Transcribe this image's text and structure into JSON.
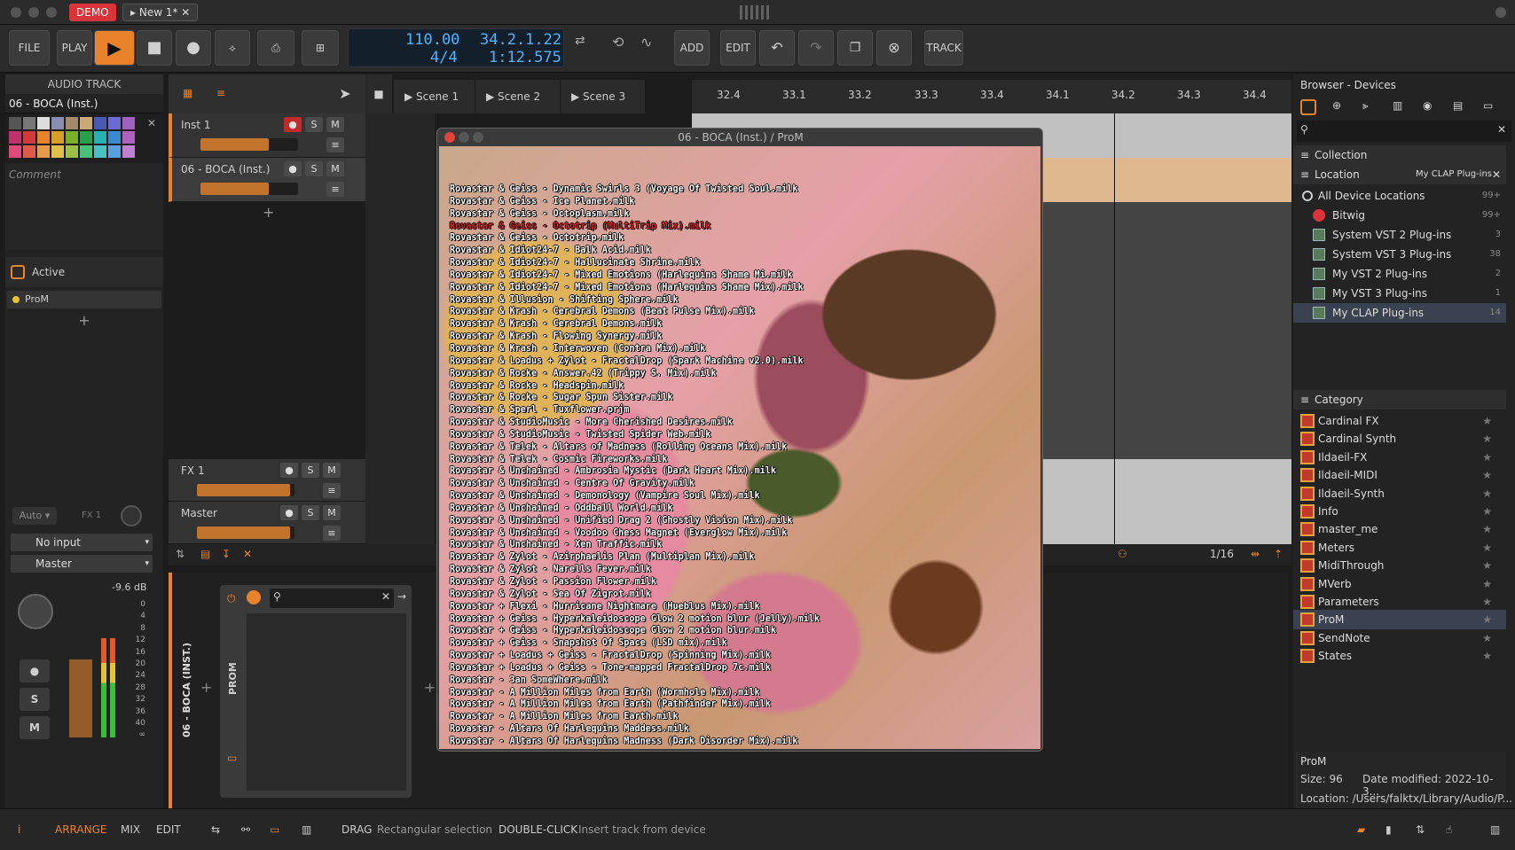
{
  "window": {
    "demo": "DEMO",
    "doc_tab": "New 1*",
    "tab_close": "✕"
  },
  "toolbar": {
    "file": "FILE",
    "play": "PLAY",
    "add": "ADD",
    "edit": "EDIT",
    "track": "TRACK",
    "tempo": "110.00",
    "signature": "4/4",
    "position": "34.2.1.22",
    "time": "1:12.575"
  },
  "inspector": {
    "title": "AUDIO TRACK",
    "track_name": "06 - BOCA (Inst.)",
    "comment": "Comment",
    "active": "Active",
    "device": "ProM",
    "auto": "Auto",
    "fx": "FX 1",
    "input": "No input",
    "output": "Master",
    "db": "-9.6 dB",
    "scale": [
      "0",
      "4",
      "8",
      "12",
      "16",
      "20",
      "24",
      "28",
      "32",
      "36",
      "40",
      "∞"
    ]
  },
  "tracks": [
    {
      "name": "Inst 1"
    },
    {
      "name": "06 - BOCA (Inst.)"
    },
    {
      "name": "FX 1"
    },
    {
      "name": "Master"
    }
  ],
  "scenes": [
    "Scene 1",
    "Scene 2",
    "Scene 3"
  ],
  "ruler": [
    "32.4",
    "33.1",
    "33.2",
    "33.3",
    "33.4",
    "34.1",
    "34.2",
    "34.3",
    "34.4"
  ],
  "grid": "1/16",
  "device_panel": {
    "track_label": "06 - BOCA (INST.)",
    "device_label": "PROM"
  },
  "plugin": {
    "title": "06 - BOCA (Inst.) / ProM",
    "selected_index": 3,
    "presets": [
      "Rovastar & Geiss - Dynamic Swirls 3 (Voyage Of Twisted Soul.milk",
      "Rovastar & Geiss - Ice Planet.milk",
      "Rovastar & Geiss - Octoplasm.milk",
      "Rovastar & Geiss - Octotrip (MultiTrip Mix).milk",
      "Rovastar & Geiss - Octotrip.milk",
      "Rovastar & Idiot24-7 - Balk Acid.milk",
      "Rovastar & Idiot24-7 - Hallucinate Shrine.milk",
      "Rovastar & Idiot24-7 - Mixed Emotions (Harlequins Shame Mi.milk",
      "Rovastar & Idiot24-7 - Mixed Emotions (Harlequins Shame Mix).milk",
      "Rovastar & Illusion - Shifting Sphere.milk",
      "Rovastar & Krash - Cerebral Demons (Beat Pulse Mix).milk",
      "Rovastar & Krash - Cerebral Demons.milk",
      "Rovastar & Krash - Flowing Synergy.milk",
      "Rovastar & Krash - Interwoven (Contra Mix).milk",
      "Rovastar & Loadus + Zylot - FractalDrop (Spark Machine v2.0).milk",
      "Rovastar & Rocke - Answer.42 (Trippy S. Mix).milk",
      "Rovastar & Rocke - Headspin.milk",
      "Rovastar & Rocke - Sugar Spun Sister.milk",
      "Rovastar & Sperl - Tuxflower.prjm",
      "Rovastar & StudioMusic - More Cherished Desires.milk",
      "Rovastar & StudioMusic - Twisted Spider Web.milk",
      "Rovastar & Telek - Altars of Madness (Rolling Oceans Mix).milk",
      "Rovastar & Telek - Cosmic Fireworks.milk",
      "Rovastar & Unchained - Ambrosia Mystic (Dark Heart Mix).milk",
      "Rovastar & Unchained - Centre Of Gravity.milk",
      "Rovastar & Unchained - Demonology (Vampire Soul Mix).milk",
      "Rovastar & Unchained - Oddball World.milk",
      "Rovastar & Unchained - Unified Drag 2 (Ghostly Vision Mix).milk",
      "Rovastar & Unchained - Voodoo Chess Magnet (Everglow Mix).milk",
      "Rovastar & Unchained - Xen Traffic.milk",
      "Rovastar & Zylot - Azirphaelis Plan (Multiplan Mix).milk",
      "Rovastar & Zylot - Narells Fever.milk",
      "Rovastar & Zylot - Passion Flower.milk",
      "Rovastar & Zylot - Sea Of Zigrot.milk",
      "Rovastar + Flexi - Hurricane Nightmare (Hueblus Mix).milk",
      "Rovastar + Geiss - Hyperkaleidoscope Glow 2 motion blur (Jelly).milk",
      "Rovastar + Geiss - Hyperkaleidoscope Glow 2 motion blur.milk",
      "Rovastar + Geiss - Snapshot Of Space (LSD mix).milk",
      "Rovastar + Loadus + Geiss - FractalDrop (Spinning Mix).milk",
      "Rovastar + Loadus + Geiss - Tone-mapped FractalDrop 7c.milk",
      "Rovastar - 3an SomeWhere.milk",
      "Rovastar - A Million Miles from Earth (Wormhole Mix).milk",
      "Rovastar - A Million Miles from Earth (Pathfinder Mix).milk",
      "Rovastar - A Million Miles from Earth.milk",
      "Rovastar - Altars Of Harlequins Maddess.milk",
      "Rovastar - Altars Of Harlequins Madness (Dark Disorder Mix).milk"
    ]
  },
  "browser": {
    "title": "Browser - Devices",
    "collection": "Collection",
    "location": "Location",
    "location_value": "My CLAP Plug-ins",
    "locations": [
      {
        "label": "All Device Locations",
        "count": "99+"
      },
      {
        "label": "Bitwig",
        "count": "99+"
      },
      {
        "label": "System VST 2 Plug-ins",
        "count": "3"
      },
      {
        "label": "System VST 3 Plug-ins",
        "count": "38"
      },
      {
        "label": "My VST 2 Plug-ins",
        "count": "2"
      },
      {
        "label": "My VST 3 Plug-ins",
        "count": "1"
      },
      {
        "label": "My CLAP Plug-ins",
        "count": "14"
      }
    ],
    "category": "Category",
    "devices": [
      "Cardinal FX",
      "Cardinal Synth",
      "Ildaeil-FX",
      "Ildaeil-MIDI",
      "Ildaeil-Synth",
      "Info",
      "master_me",
      "Meters",
      "MidiThrough",
      "MVerb",
      "Parameters",
      "ProM",
      "SendNote",
      "States"
    ],
    "info_name": "ProM",
    "info_size": "Size: 96",
    "info_date": "Date modified: 2022-10-3...",
    "info_location": "Location: /Users/falktx/Library/Audio/P..."
  },
  "status": {
    "arrange": "ARRANGE",
    "mix": "MIX",
    "edit": "EDIT",
    "drag_key": "DRAG",
    "drag_desc": "Rectangular selection",
    "dbl_key": "DOUBLE-CLICK",
    "dbl_desc": "Insert track from device"
  },
  "colors": {
    "accent": "#e8822b",
    "record": "#d9343a",
    "lcd": "#4fb3ff"
  }
}
